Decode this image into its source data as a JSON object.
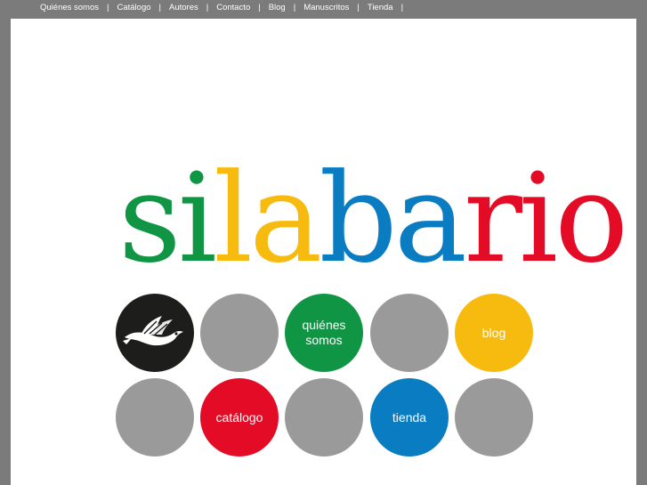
{
  "nav": {
    "items": [
      {
        "label": "Quiénes somos"
      },
      {
        "label": "Catálogo"
      },
      {
        "label": "Autores"
      },
      {
        "label": "Contacto"
      },
      {
        "label": "Blog"
      },
      {
        "label": "Manuscritos"
      },
      {
        "label": "Tienda"
      }
    ],
    "separator": "|"
  },
  "logo": {
    "text": "silabario",
    "letters": [
      {
        "char": "s",
        "color": "#109545"
      },
      {
        "char": "i",
        "color": "#109545"
      },
      {
        "char": "l",
        "color": "#f7bb10"
      },
      {
        "char": "a",
        "color": "#f7bb10"
      },
      {
        "char": "b",
        "color": "#0a7cc1"
      },
      {
        "char": "a",
        "color": "#0a7cc1"
      },
      {
        "char": "r",
        "color": "#e30b25"
      },
      {
        "char": "i",
        "color": "#e30b25"
      },
      {
        "char": "o",
        "color": "#e30b25"
      }
    ]
  },
  "circles": {
    "bird": {
      "icon": "bird-icon",
      "color": "#1d1d1b"
    },
    "quienes": {
      "label_line1": "quiénes",
      "label_line2": "somos",
      "color": "#109545"
    },
    "blog": {
      "label": "blog",
      "color": "#f7bb10"
    },
    "catalogo": {
      "label": "catálogo",
      "color": "#e30b25"
    },
    "tienda": {
      "label": "tienda",
      "color": "#0a7cc1"
    },
    "grey": {
      "color": "#9a9a9a"
    }
  }
}
